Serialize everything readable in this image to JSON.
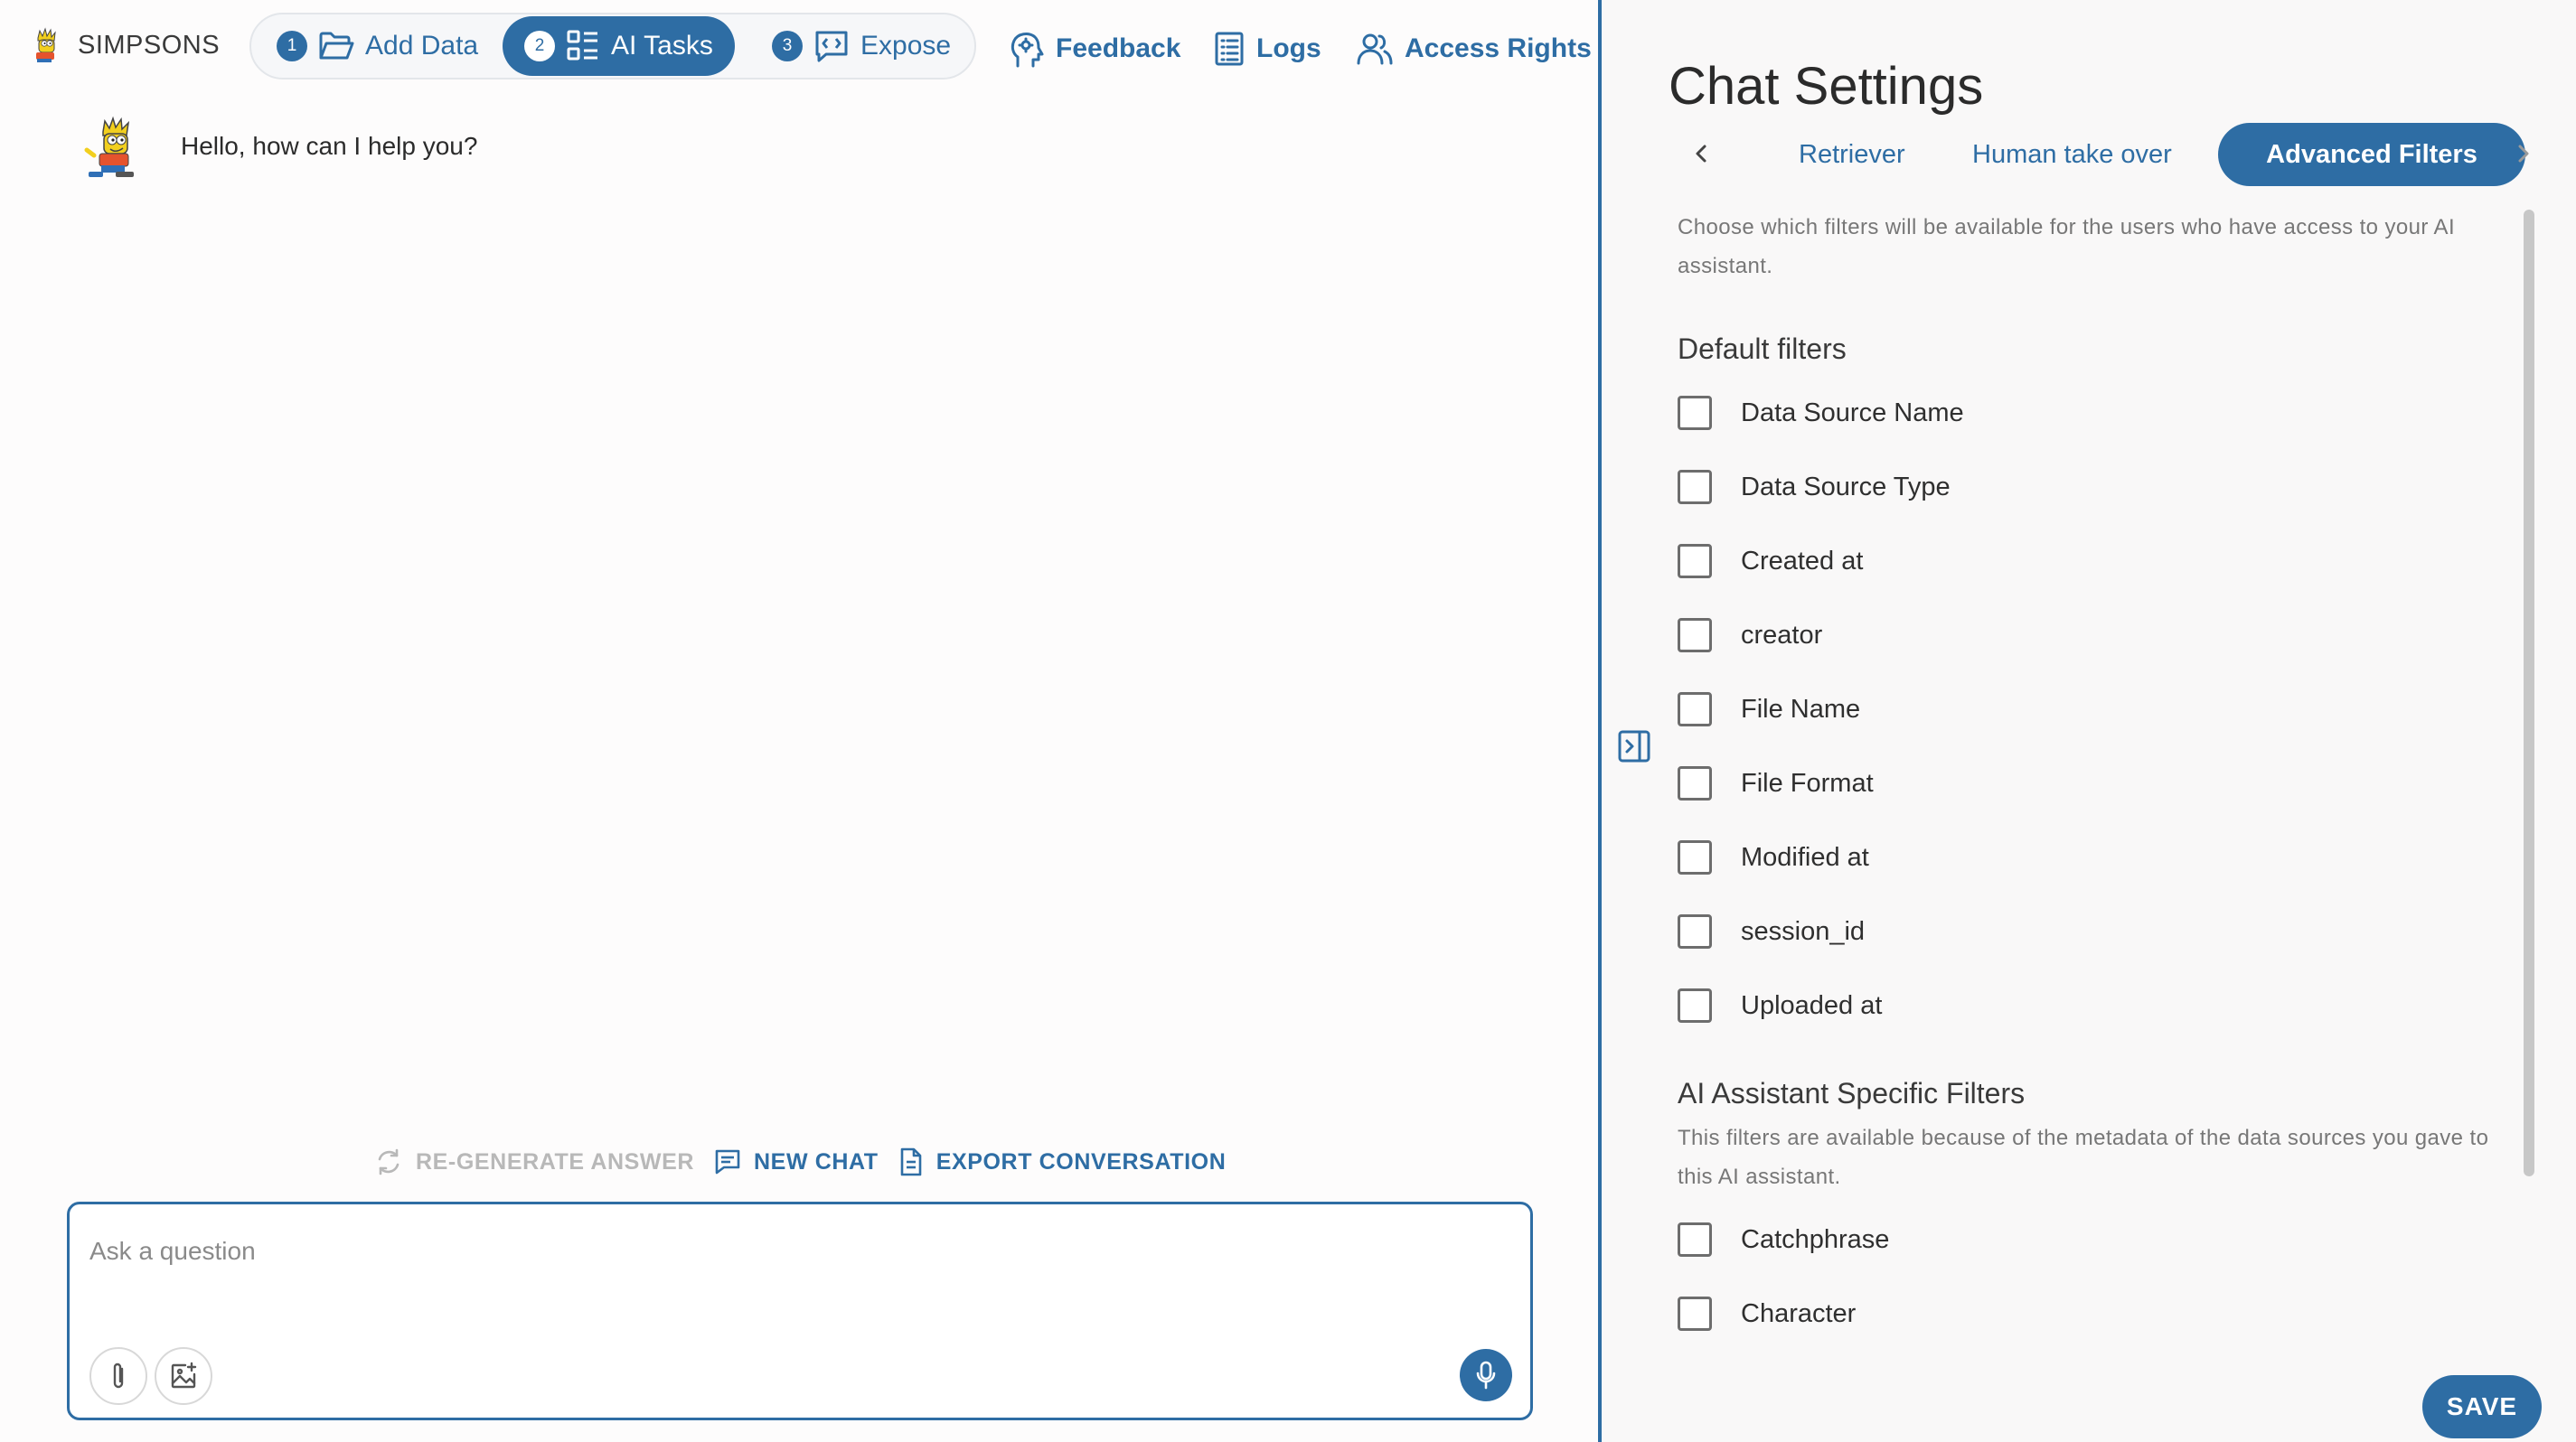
{
  "brand": {
    "name": "SIMPSONS",
    "logo_icon": "bart-simpson-icon"
  },
  "stepper": [
    {
      "number": "1",
      "label": "Add Data",
      "icon": "folder-open-icon"
    },
    {
      "number": "2",
      "label": "AI Tasks",
      "icon": "grid-list-icon",
      "active": true
    },
    {
      "number": "3",
      "label": "Expose",
      "icon": "code-chat-icon"
    }
  ],
  "nav": {
    "feedback": "Feedback",
    "logs": "Logs",
    "access_rights": "Access Rights"
  },
  "chat": {
    "greeting": "Hello, how can I help you?",
    "actions": {
      "regenerate": "RE-GENERATE ANSWER",
      "new_chat": "NEW CHAT",
      "export": "EXPORT CONVERSATION"
    },
    "input_placeholder": "Ask a question"
  },
  "panel": {
    "title": "Chat Settings",
    "tabs": [
      "Retriever",
      "Human take over",
      "Advanced Filters"
    ],
    "active_tab": "Advanced Filters",
    "description": "Choose which filters will be available for the users who have access to your AI assistant.",
    "default_filters_title": "Default filters",
    "default_filters": [
      "Data Source Name",
      "Data Source Type",
      "Created at",
      "creator",
      "File Name",
      "File Format",
      "Modified at",
      "session_id",
      "Uploaded at"
    ],
    "specific_filters_title": "AI Assistant Specific Filters",
    "specific_description": "This filters are available because of the metadata of the data sources you gave to this AI assistant.",
    "specific_filters": [
      "Catchphrase",
      "Character"
    ],
    "save_label": "SAVE"
  },
  "colors": {
    "accent": "#2e6da4",
    "disabled": "#b8b8b8",
    "muted_text": "#777777"
  }
}
